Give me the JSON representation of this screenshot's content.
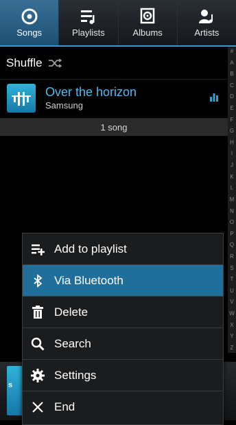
{
  "tabs": [
    {
      "label": "Songs",
      "icon": "songs-icon",
      "active": true
    },
    {
      "label": "Playlists",
      "icon": "playlists-icon",
      "active": false
    },
    {
      "label": "Albums",
      "icon": "albums-icon",
      "active": false
    },
    {
      "label": "Artists",
      "icon": "artists-icon",
      "active": false
    }
  ],
  "shuffle": {
    "label": "Shuffle",
    "icon": "shuffle-icon"
  },
  "song": {
    "title": "Over the horizon",
    "artist": "Samsung"
  },
  "song_count": "1 song",
  "index_letters": [
    "#",
    "A",
    "B",
    "C",
    "D",
    "E",
    "F",
    "G",
    "H",
    "I",
    "J",
    "K",
    "L",
    "M",
    "N",
    "O",
    "P",
    "Q",
    "R",
    "S",
    "T",
    "U",
    "V",
    "W",
    "X",
    "Y",
    "Z"
  ],
  "now_playing": {
    "art_letter": "s"
  },
  "menu": {
    "items": [
      {
        "label": "Add to playlist",
        "icon": "add-to-playlist-icon",
        "highlighted": false
      },
      {
        "label": "Via Bluetooth",
        "icon": "bluetooth-icon",
        "highlighted": true
      },
      {
        "label": "Delete",
        "icon": "trash-icon",
        "highlighted": false
      },
      {
        "label": "Search",
        "icon": "search-icon",
        "highlighted": false
      },
      {
        "label": "Settings",
        "icon": "gear-icon",
        "highlighted": false
      },
      {
        "label": "End",
        "icon": "close-icon",
        "highlighted": false
      }
    ]
  },
  "colors": {
    "accent": "#3a9bd1",
    "highlight": "#1f6f9a",
    "song_title": "#4fb8f0"
  }
}
